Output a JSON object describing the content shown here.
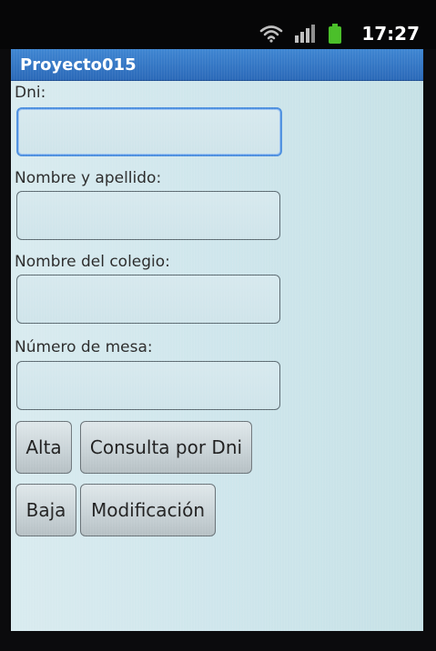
{
  "status_bar": {
    "time": "17:27",
    "icons": [
      "wifi-icon",
      "signal-icon",
      "battery-icon"
    ],
    "battery_color": "#4bbf2a"
  },
  "app": {
    "title": "Proyecto015",
    "title_bar_color": "#2f72c3"
  },
  "form": {
    "fields": [
      {
        "label": "Dni:",
        "value": "",
        "focused": true
      },
      {
        "label": "Nombre y apellido:",
        "value": ""
      },
      {
        "label": "Nombre del colegio:",
        "value": ""
      },
      {
        "label": "Número de mesa:",
        "value": ""
      }
    ]
  },
  "buttons": {
    "alta": "Alta",
    "consulta": "Consulta por Dni",
    "baja": "Baja",
    "modificacion": "Modificación"
  }
}
